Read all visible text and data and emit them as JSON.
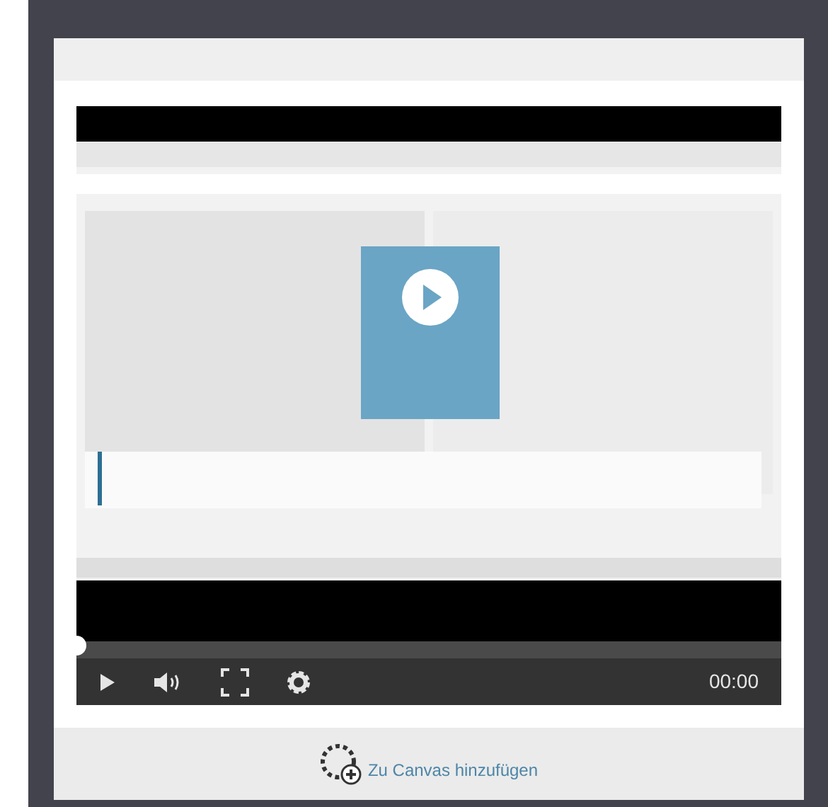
{
  "player": {
    "progress": {
      "level": 0
    },
    "time": "00:00"
  },
  "footer": {
    "link": "Zu Canvas hinzufügen"
  }
}
